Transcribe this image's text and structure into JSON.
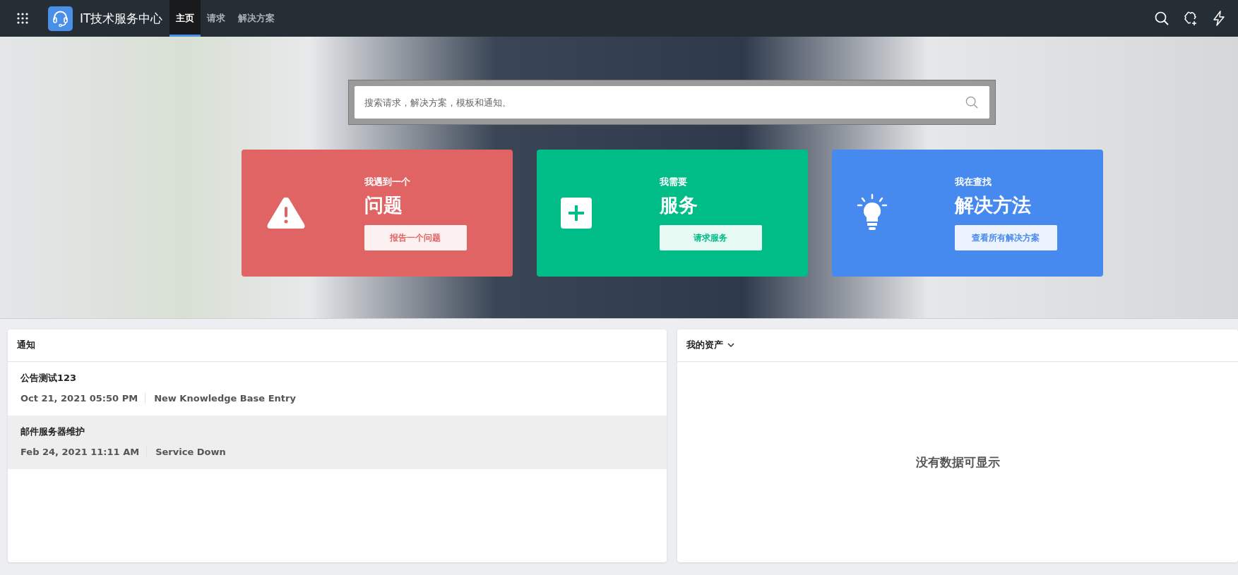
{
  "topbar": {
    "title": "IT技术服务中心",
    "tabs": [
      {
        "label": "主页",
        "selected": true
      },
      {
        "label": "请求",
        "selected": false
      },
      {
        "label": "解决方案",
        "selected": false
      }
    ]
  },
  "search": {
    "placeholder": "搜索请求，解决方案，模板和通知。"
  },
  "cards": [
    {
      "kind": "problem",
      "color": "#e06464",
      "subtitle": "我遇到一个",
      "title": "问题",
      "button": "报告一个问题"
    },
    {
      "kind": "service",
      "color": "#00bc87",
      "subtitle": "我需要",
      "title": "服务",
      "button": "请求服务"
    },
    {
      "kind": "solution",
      "color": "#4689ef",
      "subtitle": "我在查找",
      "title": "解决方法",
      "button": "查看所有解决方案"
    }
  ],
  "notices": {
    "title": "通知",
    "items": [
      {
        "title": "公告测试123",
        "date": "Oct 21, 2021 05:50 PM",
        "category": "New Knowledge Base Entry",
        "highlighted": false
      },
      {
        "title": "邮件服务器维护",
        "date": "Feb 24, 2021 11:11 AM",
        "category": "Service Down",
        "highlighted": true
      }
    ]
  },
  "assets": {
    "title": "我的资产",
    "empty": "没有数据可显示"
  }
}
